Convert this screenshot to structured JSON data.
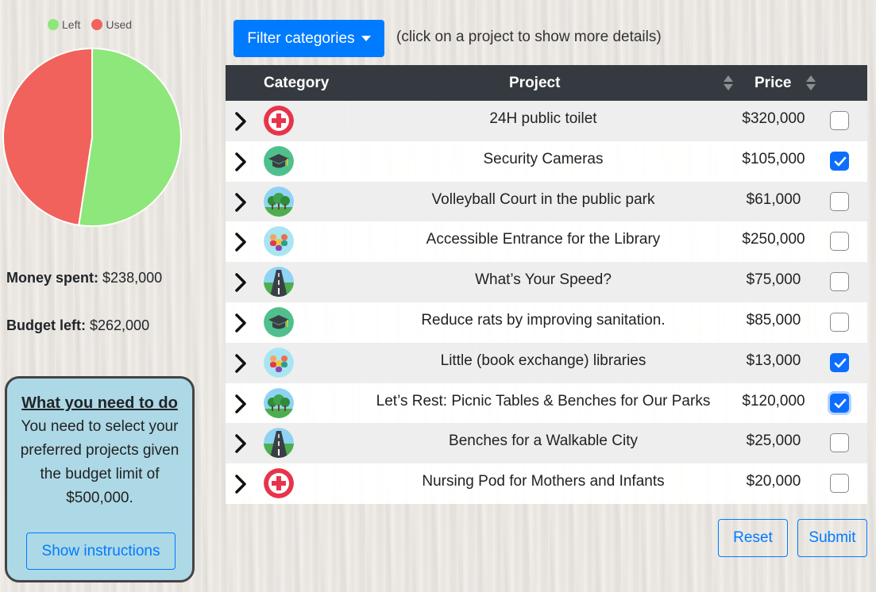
{
  "legend": [
    {
      "label": "Left",
      "color": "#8ee77a"
    },
    {
      "label": "Used",
      "color": "#f0625b"
    }
  ],
  "chart_data": {
    "type": "pie",
    "categories": [
      "Left",
      "Used"
    ],
    "values": [
      262000,
      238000
    ],
    "colors": [
      "#8ee77a",
      "#f0625b"
    ],
    "legend": "top"
  },
  "stats": {
    "money_spent_label": "Money spent:",
    "money_spent_value": "$238,000",
    "budget_left_label": "Budget left:",
    "budget_left_value": "$262,000"
  },
  "info": {
    "title": "What you need to do",
    "text": "You need to select your preferred projects given the budget limit of $500,000.",
    "button": "Show instructions"
  },
  "filter": {
    "button": "Filter categories",
    "hint": "(click on a project to show more details)"
  },
  "table": {
    "headers": {
      "category": "Category",
      "project": "Project",
      "price": "Price"
    },
    "rows": [
      {
        "icon": "health-icon",
        "project": "24H public toilet",
        "price": "$320,000",
        "checked": false
      },
      {
        "icon": "education-icon",
        "project": "Security Cameras",
        "price": "$105,000",
        "checked": true
      },
      {
        "icon": "parks-icon",
        "project": "Volleyball Court in the public park",
        "price": "$61,000",
        "checked": false
      },
      {
        "icon": "community-icon",
        "project": "Accessible Entrance for the Library",
        "price": "$250,000",
        "checked": false
      },
      {
        "icon": "roads-icon",
        "project": "What’s Your Speed?",
        "price": "$75,000",
        "checked": false
      },
      {
        "icon": "education-icon",
        "project": "Reduce rats by improving sanitation.",
        "price": "$85,000",
        "checked": false
      },
      {
        "icon": "community-icon",
        "project": "Little (book exchange) libraries",
        "price": "$13,000",
        "checked": true
      },
      {
        "icon": "parks-icon",
        "project": "Let’s Rest: Picnic Tables & Benches for Our Parks",
        "price": "$120,000",
        "checked": true,
        "focused": true
      },
      {
        "icon": "roads-icon",
        "project": "Benches for a Walkable City",
        "price": "$25,000",
        "checked": false
      },
      {
        "icon": "health-icon",
        "project": "Nursing Pod for Mothers and Infants",
        "price": "$20,000",
        "checked": false
      }
    ]
  },
  "actions": {
    "reset": "Reset",
    "submit": "Submit"
  },
  "colors": {
    "primary": "#007bff",
    "header_bg": "#343a40",
    "info_bg": "#add8e6"
  }
}
